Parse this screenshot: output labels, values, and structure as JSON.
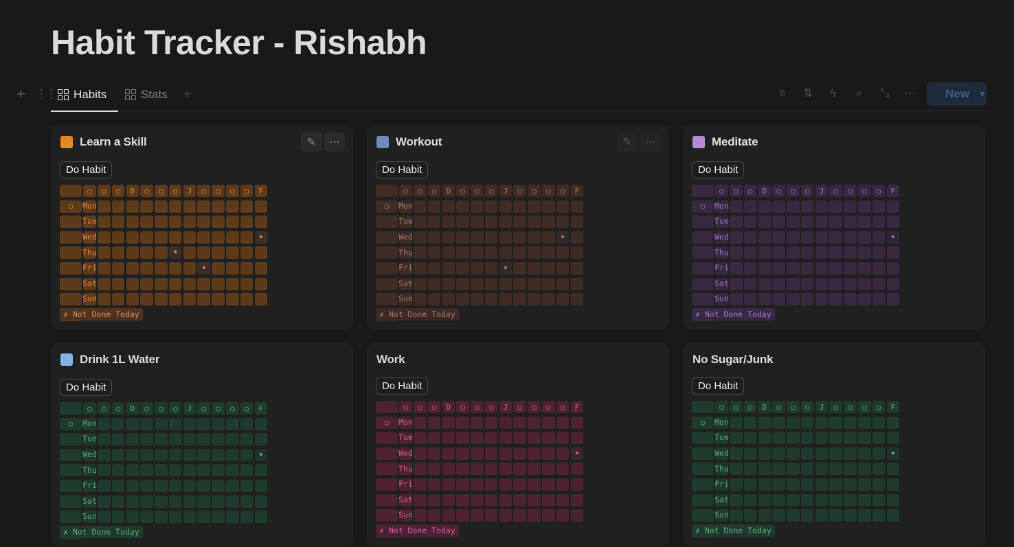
{
  "page": {
    "title": "Habit Tracker - Rishabh"
  },
  "views": [
    {
      "label": "Habits",
      "active": true
    },
    {
      "label": "Stats",
      "active": false
    }
  ],
  "toolbar": {
    "new_label": "New",
    "icons": [
      "filter-icon",
      "sort-icon",
      "lightning-icon",
      "search-icon",
      "expand-icon",
      "more-icon"
    ]
  },
  "grid_header": [
    "",
    "○",
    "○",
    "○",
    "D",
    "○",
    "○",
    "○",
    "J",
    "○",
    "○",
    "○",
    "○",
    "F",
    "○"
  ],
  "days": [
    "Mon",
    "Tue",
    "Wed",
    "Thu",
    "Fri",
    "Sat",
    "Sun"
  ],
  "cards": [
    {
      "title": "Learn a Skill",
      "icon": "book-icon",
      "emoji_color": "#e58a22",
      "button": "Do Habit",
      "status": "✗ Not Done Today",
      "colors": {
        "cell": "#5c3a1c",
        "text": "#d6893f",
        "status_bg": "#4e3420",
        "status_fg": "#d3905a",
        "marker": "#3a2f28"
      },
      "marks": [
        [
          "Wed",
          12
        ],
        [
          "Thu",
          6
        ],
        [
          "Fri",
          8
        ]
      ],
      "sun_last_circle": true,
      "show_actions": true
    },
    {
      "title": "Workout",
      "icon": "running-person-icon",
      "emoji_color": "#6e8bb5",
      "button": "Do Habit",
      "status": "✗ Not Done Today",
      "colors": {
        "cell": "#3e2b24",
        "text": "#9e7b6b",
        "status_bg": "#3b2a25",
        "status_fg": "#a07d6f",
        "marker": "#33292a"
      },
      "marks": [
        [
          "Wed",
          11
        ],
        [
          "Fri",
          7
        ]
      ],
      "sun_last_circle": true,
      "show_actions": true
    },
    {
      "title": "Meditate",
      "icon": "meditation-icon",
      "emoji_color": "#b78ad8",
      "button": "Do Habit",
      "status": "✗ Not Done Today",
      "colors": {
        "cell": "#37283f",
        "text": "#9c6fc2",
        "status_bg": "#382a42",
        "status_fg": "#a079c6",
        "marker": "#2d2634"
      },
      "marks": [
        [
          "Wed",
          12
        ]
      ],
      "sun_last_circle": true,
      "show_actions": false
    },
    {
      "title": "Drink 1L Water",
      "icon": "cup-icon",
      "emoji_color": "#7fb4e0",
      "button": "Do Habit",
      "status": "✗ Not Done Today",
      "colors": {
        "cell": "#1f3a2c",
        "text": "#5aa67d",
        "status_bg": "#213a2d",
        "status_fg": "#62ab84",
        "marker": "#22302a"
      },
      "marks": [
        [
          "Wed",
          12
        ]
      ],
      "sun_last_circle": true,
      "show_actions": false
    },
    {
      "title": "Work",
      "icon": "",
      "emoji_color": "",
      "button": "Do Habit",
      "status": "✗ Not Done Today",
      "colors": {
        "cell": "#4a2232",
        "text": "#d35c8b",
        "status_bg": "#4a2234",
        "status_fg": "#d4628f",
        "marker": "#3a2530"
      },
      "marks": [
        [
          "Wed",
          12
        ]
      ],
      "sun_last_circle": true,
      "show_actions": false
    },
    {
      "title": "No Sugar/Junk",
      "icon": "",
      "emoji_color": "",
      "button": "Do Habit",
      "status": "✗ Not Done Today",
      "colors": {
        "cell": "#1f3a2c",
        "text": "#5aa67d",
        "status_bg": "#213a2d",
        "status_fg": "#62ab84",
        "marker": "#22302a"
      },
      "marks": [
        [
          "Wed",
          12
        ]
      ],
      "sun_last_circle": true,
      "show_actions": false
    }
  ]
}
